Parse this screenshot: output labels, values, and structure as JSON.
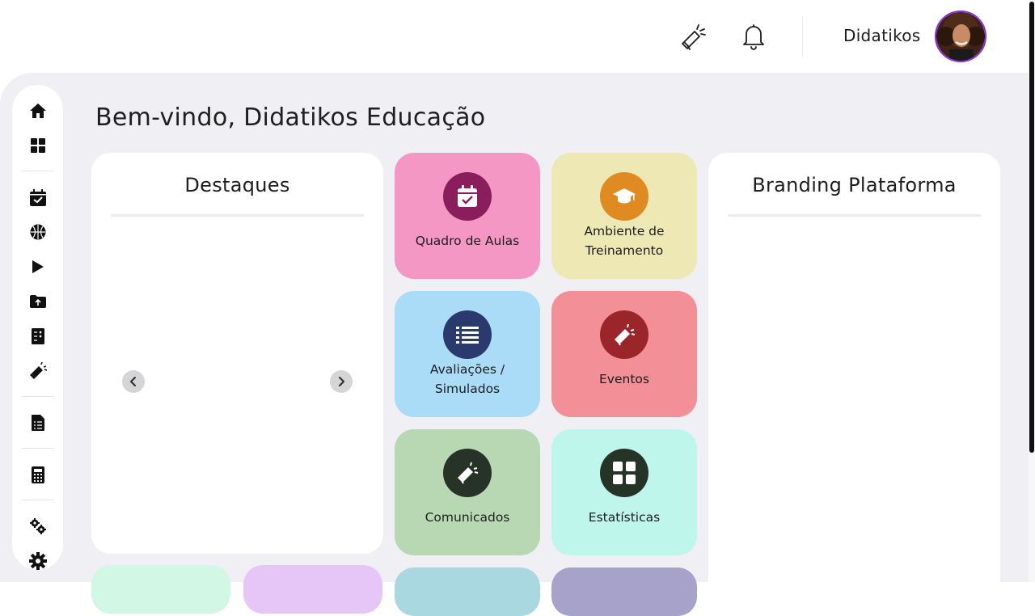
{
  "header": {
    "user_name": "Didatikos",
    "icons": [
      "megaphone-icon",
      "bell-icon"
    ]
  },
  "welcome": "Bem-vindo, Didatikos Educação",
  "sidebar": {
    "items": [
      "home-icon",
      "dashboard-icon",
      "calendar-icon",
      "basketball-icon",
      "play-icon",
      "folder-upload-icon",
      "report-icon",
      "megaphone-icon",
      "document-list-icon",
      "calculator-icon",
      "cogs-icon",
      "settings-icon"
    ]
  },
  "highlights": {
    "title": "Destaques"
  },
  "branding": {
    "title": "Branding Plataforma"
  },
  "tiles": [
    {
      "label": "Quadro de Aulas",
      "bg": "#f497c4",
      "icon_bg": "#8a1d5c",
      "icon": "calendar-check-icon"
    },
    {
      "label": "Ambiente de\nTreinamento",
      "bg": "#ede8b4",
      "icon_bg": "#e08a22",
      "icon": "graduation-cap-icon"
    },
    {
      "label": "Avaliações /\nSimulados",
      "bg": "#aadcf8",
      "icon_bg": "#2a3a6e",
      "icon": "list-icon"
    },
    {
      "label": "Eventos",
      "bg": "#f38f97",
      "icon_bg": "#9a2629",
      "icon": "megaphone-icon"
    },
    {
      "label": "Comunicados",
      "bg": "#b8d8b4",
      "icon_bg": "#283327",
      "icon": "megaphone-icon"
    },
    {
      "label": "Estatísticas",
      "bg": "#bef6ec",
      "icon_bg": "#253426",
      "icon": "grid-icon"
    }
  ],
  "bottom_tiles_colors": [
    "#d2f7e4",
    "#e5c6f6",
    "#a9d8e0",
    "#a7a2c9"
  ]
}
